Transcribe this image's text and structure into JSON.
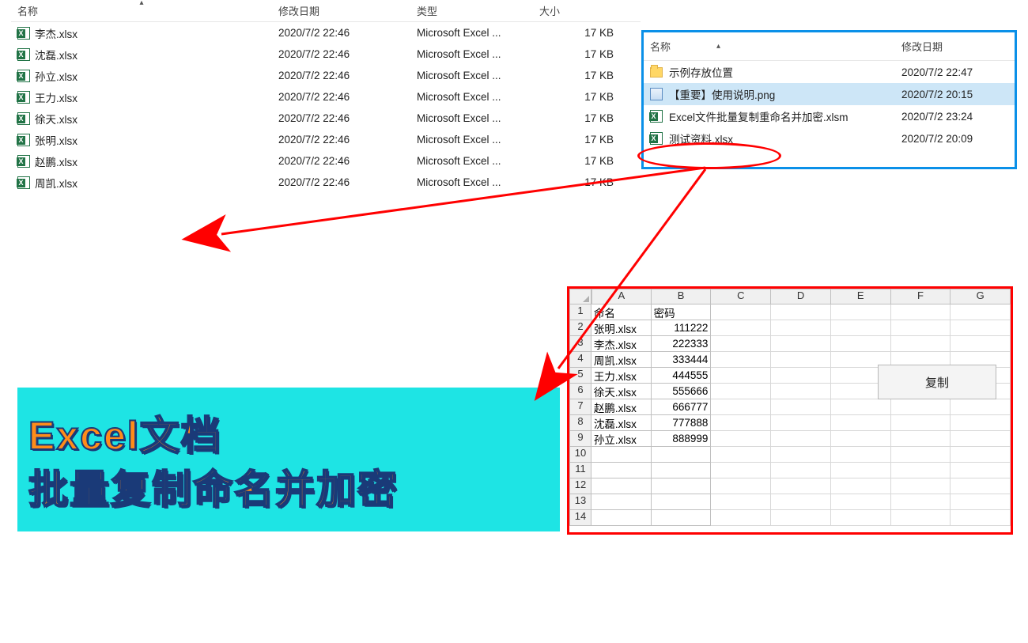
{
  "left_explorer": {
    "columns": {
      "name": "名称",
      "date": "修改日期",
      "type": "类型",
      "size": "大小"
    },
    "sort_indicator": "▴",
    "rows": [
      {
        "name": "李杰.xlsx",
        "date": "2020/7/2 22:46",
        "type": "Microsoft Excel ...",
        "size": "17 KB"
      },
      {
        "name": "沈磊.xlsx",
        "date": "2020/7/2 22:46",
        "type": "Microsoft Excel ...",
        "size": "17 KB"
      },
      {
        "name": "孙立.xlsx",
        "date": "2020/7/2 22:46",
        "type": "Microsoft Excel ...",
        "size": "17 KB"
      },
      {
        "name": "王力.xlsx",
        "date": "2020/7/2 22:46",
        "type": "Microsoft Excel ...",
        "size": "17 KB"
      },
      {
        "name": "徐天.xlsx",
        "date": "2020/7/2 22:46",
        "type": "Microsoft Excel ...",
        "size": "17 KB"
      },
      {
        "name": "张明.xlsx",
        "date": "2020/7/2 22:46",
        "type": "Microsoft Excel ...",
        "size": "17 KB"
      },
      {
        "name": "赵鹏.xlsx",
        "date": "2020/7/2 22:46",
        "type": "Microsoft Excel ...",
        "size": "17 KB"
      },
      {
        "name": "周凯.xlsx",
        "date": "2020/7/2 22:46",
        "type": "Microsoft Excel ...",
        "size": "17 KB"
      }
    ]
  },
  "right_explorer": {
    "columns": {
      "name": "名称",
      "date": "修改日期"
    },
    "sort_indicator": "▴",
    "rows": [
      {
        "icon": "folder",
        "name": "示例存放位置",
        "date": "2020/7/2 22:47",
        "selected": false
      },
      {
        "icon": "png",
        "name": "【重要】使用说明.png",
        "date": "2020/7/2 20:15",
        "selected": true
      },
      {
        "icon": "xlsx",
        "name": "Excel文件批量复制重命名并加密.xlsm",
        "date": "2020/7/2 23:24",
        "selected": false
      },
      {
        "icon": "xlsx",
        "name": "测试资料.xlsx",
        "date": "2020/7/2 20:09",
        "selected": false
      }
    ]
  },
  "excel": {
    "col_letters": [
      "A",
      "B",
      "C",
      "D",
      "E",
      "F",
      "G"
    ],
    "header": {
      "A": "命名",
      "B": "密码"
    },
    "rows": [
      {
        "name": "张明.xlsx",
        "pwd": "111222"
      },
      {
        "name": "李杰.xlsx",
        "pwd": "222333"
      },
      {
        "name": "周凯.xlsx",
        "pwd": "333444"
      },
      {
        "name": "王力.xlsx",
        "pwd": "444555"
      },
      {
        "name": "徐天.xlsx",
        "pwd": "555666"
      },
      {
        "name": "赵鹏.xlsx",
        "pwd": "666777"
      },
      {
        "name": "沈磊.xlsx",
        "pwd": "777888"
      },
      {
        "name": "孙立.xlsx",
        "pwd": "888999"
      }
    ],
    "empty_rows": [
      10,
      11,
      12,
      13,
      14
    ],
    "button": "复制"
  },
  "caption": {
    "line1": "Excel文档",
    "line2": "批量复制命名并加密"
  }
}
